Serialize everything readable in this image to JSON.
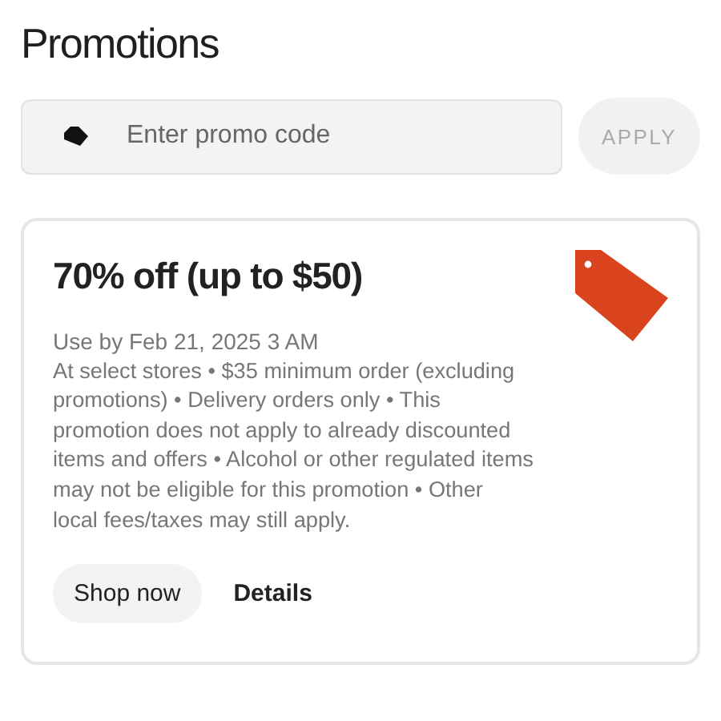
{
  "title": "Promotions",
  "promo_field": {
    "placeholder": "Enter promo code"
  },
  "apply_button": {
    "label": "APPLY",
    "disabled": true
  },
  "promotion": {
    "title": "70% off (up to $50)",
    "expiry": "Use by Feb 21, 2025 3 AM",
    "terms": "At select stores • $35 minimum order (excluding promotions) • Delivery orders only • This promotion does not apply to already discounted items and offers • Alcohol or other regulated items may not be eligible for this promotion • Other local fees/taxes may still apply.",
    "actions": [
      {
        "label": "Shop now",
        "kind": "pill"
      },
      {
        "label": "Details",
        "kind": "link"
      }
    ]
  }
}
